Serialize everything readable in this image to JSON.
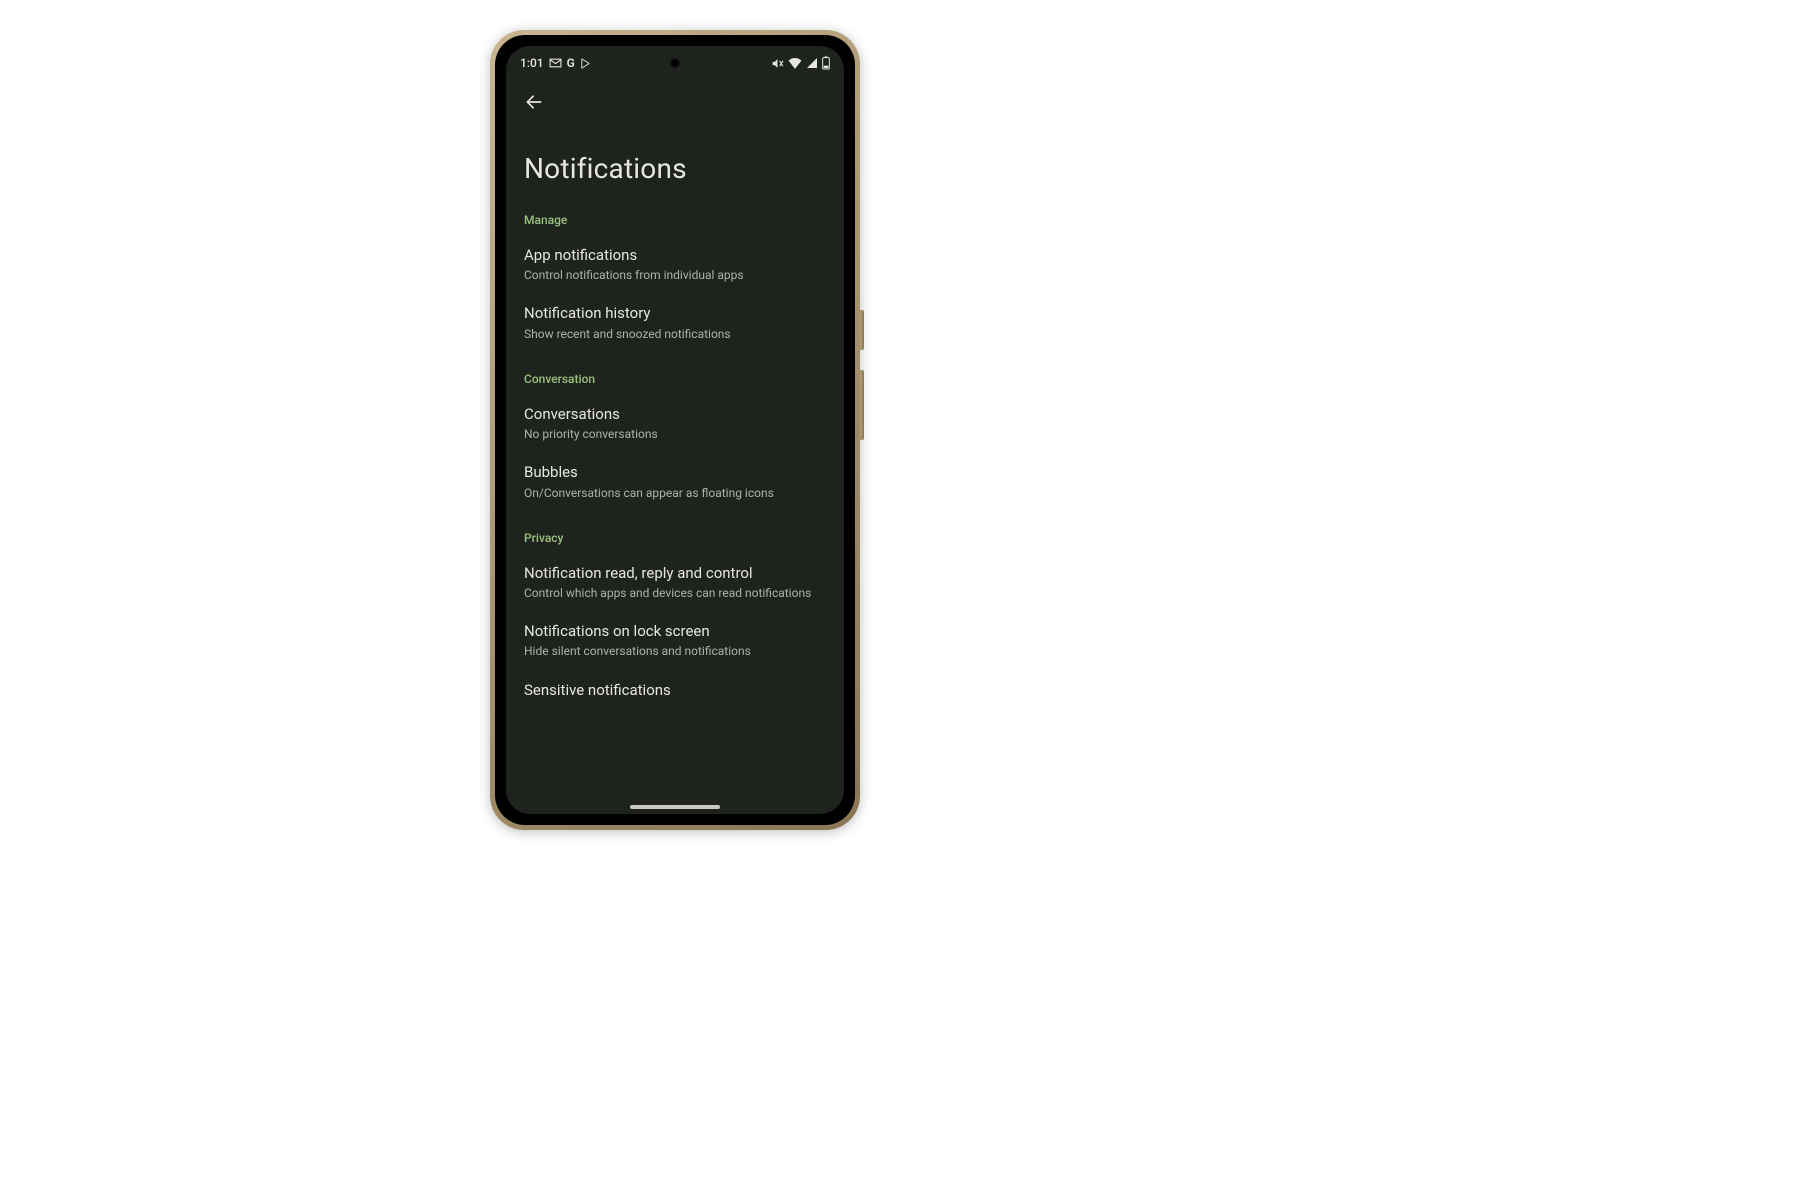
{
  "status": {
    "time": "1:01",
    "left_icons": [
      "gmail-icon",
      "google-icon",
      "play-icon"
    ],
    "right_icons": [
      "mute-icon",
      "wifi-icon",
      "signal-icon",
      "battery-icon"
    ]
  },
  "header": {
    "back": "Back",
    "title": "Notifications"
  },
  "sections": [
    {
      "header": "Manage",
      "items": [
        {
          "title": "App notifications",
          "sub": "Control notifications from individual apps"
        },
        {
          "title": "Notification history",
          "sub": "Show recent and snoozed notifications"
        }
      ]
    },
    {
      "header": "Conversation",
      "items": [
        {
          "title": "Conversations",
          "sub": "No priority conversations"
        },
        {
          "title": "Bubbles",
          "sub": "On/Conversations can appear as floating icons"
        }
      ]
    },
    {
      "header": "Privacy",
      "items": [
        {
          "title": "Notification read, reply and control",
          "sub": "Control which apps and devices can read notifications"
        },
        {
          "title": "Notifications on lock screen",
          "sub": "Hide silent conversations and notifications"
        }
      ]
    }
  ],
  "cutoff_item": {
    "title": "Sensitive notifications"
  }
}
